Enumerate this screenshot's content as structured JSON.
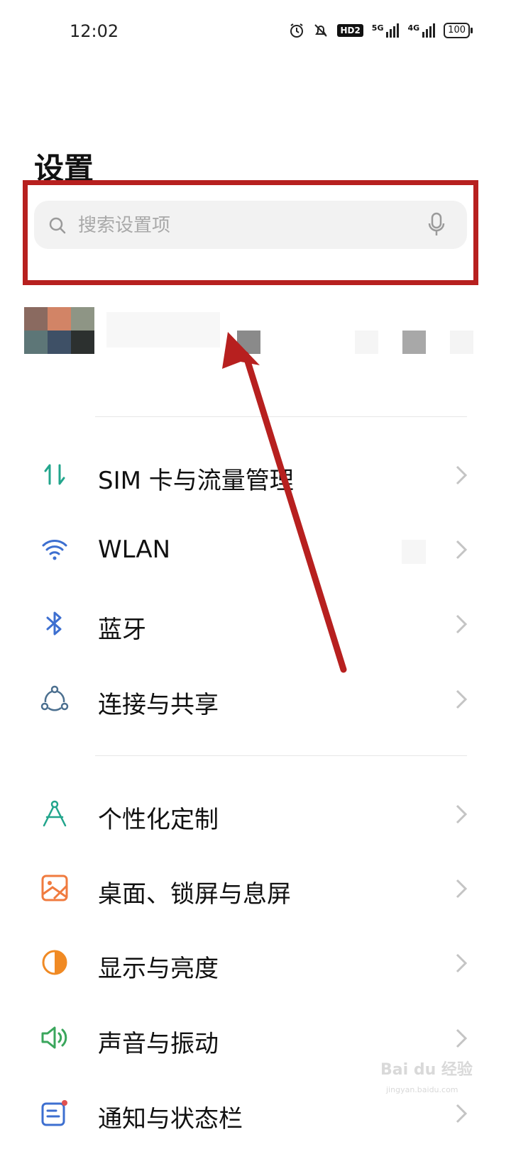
{
  "status_bar": {
    "time": "12:02",
    "hd_label": "HD2",
    "net1_label": "5G",
    "net2_label": "4G",
    "battery": "100"
  },
  "page": {
    "title": "设置"
  },
  "search": {
    "placeholder": "搜索设置项"
  },
  "settings": [
    {
      "label": "SIM 卡与流量管理",
      "icon": "sim-data-icon",
      "color": "#22a58c"
    },
    {
      "label": "WLAN",
      "icon": "wifi-icon",
      "color": "#3d6fd0"
    },
    {
      "label": "蓝牙",
      "icon": "bluetooth-icon",
      "color": "#3d6fd0"
    },
    {
      "label": "连接与共享",
      "icon": "connection-icon",
      "color": "#4b6f8f"
    },
    {
      "label": "个性化定制",
      "icon": "customize-icon",
      "color": "#22a58c"
    },
    {
      "label": "桌面、锁屏与息屏",
      "icon": "wallpaper-icon",
      "color": "#f07b3f"
    },
    {
      "label": "显示与亮度",
      "icon": "display-icon",
      "color": "#f08a24"
    },
    {
      "label": "声音与振动",
      "icon": "sound-icon",
      "color": "#3aa65c"
    },
    {
      "label": "通知与状态栏",
      "icon": "notification-icon",
      "color": "#3d6fd0"
    }
  ],
  "annotation": {
    "color": "#b7201f"
  },
  "watermark": {
    "brand": "Bai du 经验",
    "url": "jingyan.baidu.com"
  }
}
